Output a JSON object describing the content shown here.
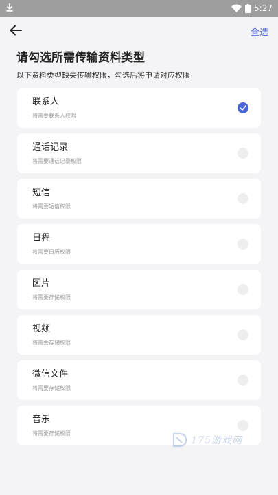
{
  "status_bar": {
    "time": "5:27",
    "icons": [
      "download-icon",
      "wifi-icon",
      "battery-icon"
    ]
  },
  "header": {
    "back_icon": "arrow-left-icon",
    "select_all_label": "全选"
  },
  "page": {
    "title": "请勾选所需传输资料类型",
    "subtitle": "以下资料类型缺失传输权限，勾选后将申请对应权限"
  },
  "items": [
    {
      "title": "联系人",
      "desc": "将需要联系人权限",
      "checked": true
    },
    {
      "title": "通话记录",
      "desc": "将需要通话记录权限",
      "checked": false
    },
    {
      "title": "短信",
      "desc": "将需要短信权限",
      "checked": false
    },
    {
      "title": "日程",
      "desc": "将需要日历权限",
      "checked": false
    },
    {
      "title": "图片",
      "desc": "将需要存储权限",
      "checked": false
    },
    {
      "title": "视频",
      "desc": "将需要存储权限",
      "checked": false
    },
    {
      "title": "微信文件",
      "desc": "将需要存储权限",
      "checked": false
    },
    {
      "title": "音乐",
      "desc": "将需要存储权限",
      "checked": false
    }
  ],
  "watermark": {
    "text": "175游戏网"
  },
  "colors": {
    "accent": "#4a67d6",
    "background": "#f4f4f6",
    "status_bar": "#9e9e9e"
  }
}
